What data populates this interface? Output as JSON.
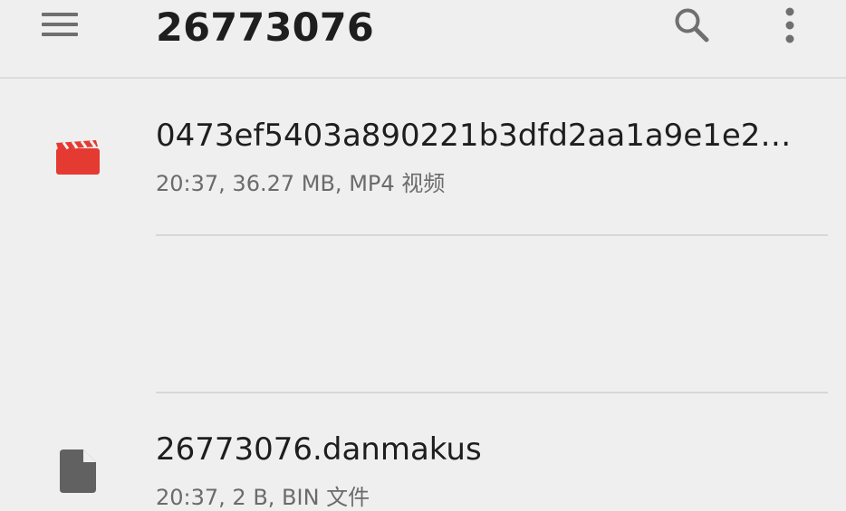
{
  "app_bar": {
    "title": "26773076",
    "menu_icon": "hamburger-menu-icon",
    "search_icon": "search-icon",
    "more_icon": "more-vert-icon"
  },
  "files": [
    {
      "name": "0473ef5403a890221b3dfd2aa1a9e1e2…",
      "meta": "20:37, 36.27 MB, MP4 视频",
      "icon": "video-clapperboard-icon",
      "icon_color": "#e53a32"
    },
    {
      "name": "26773076.danmakus",
      "meta": "20:37, 2 B, BIN 文件",
      "icon": "generic-file-icon",
      "icon_color": "#616161"
    }
  ]
}
